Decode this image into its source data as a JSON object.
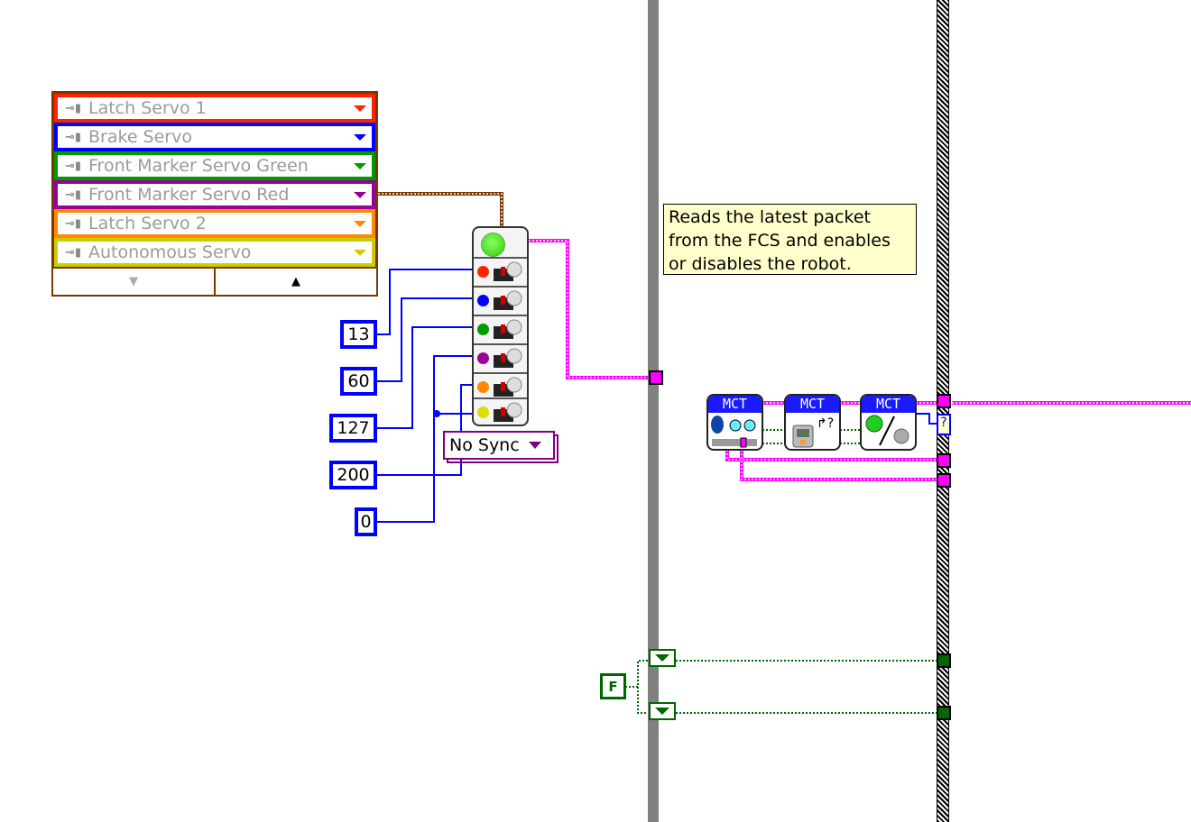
{
  "servo_list": {
    "items": [
      {
        "label": "Latch Servo 1",
        "color": "#ff2200"
      },
      {
        "label": "Brake Servo",
        "color": "#0000ff"
      },
      {
        "label": "Front Marker Servo Green",
        "color": "#009900"
      },
      {
        "label": "Front Marker Servo Red",
        "color": "#990099"
      },
      {
        "label": "Latch Servo 2",
        "color": "#ff8800"
      },
      {
        "label": "Autonomous Servo",
        "color": "#cccc00"
      }
    ],
    "plug_glyph": "⊸▮",
    "scroll_down_icon": "▼",
    "scroll_up_icon": "▲"
  },
  "constants": [
    "13",
    "60",
    "127",
    "200",
    "0"
  ],
  "sync_mode": "No Sync",
  "comment": "Reads the latest packet from the FCS and enables or disables the robot.",
  "mct_nodes": [
    {
      "label": "MCT",
      "icon": "bluetooth-read"
    },
    {
      "label": "MCT",
      "icon": "nxt-status"
    },
    {
      "label": "MCT",
      "icon": "enable-disable"
    }
  ],
  "bool_constant": "F",
  "question_indicator": "?",
  "colors": {
    "wire_servo": "#7a3800",
    "wire_int": "#0000ff",
    "wire_cluster": "#ff00ff",
    "wire_bool": "#006600",
    "structure": "#808080"
  }
}
